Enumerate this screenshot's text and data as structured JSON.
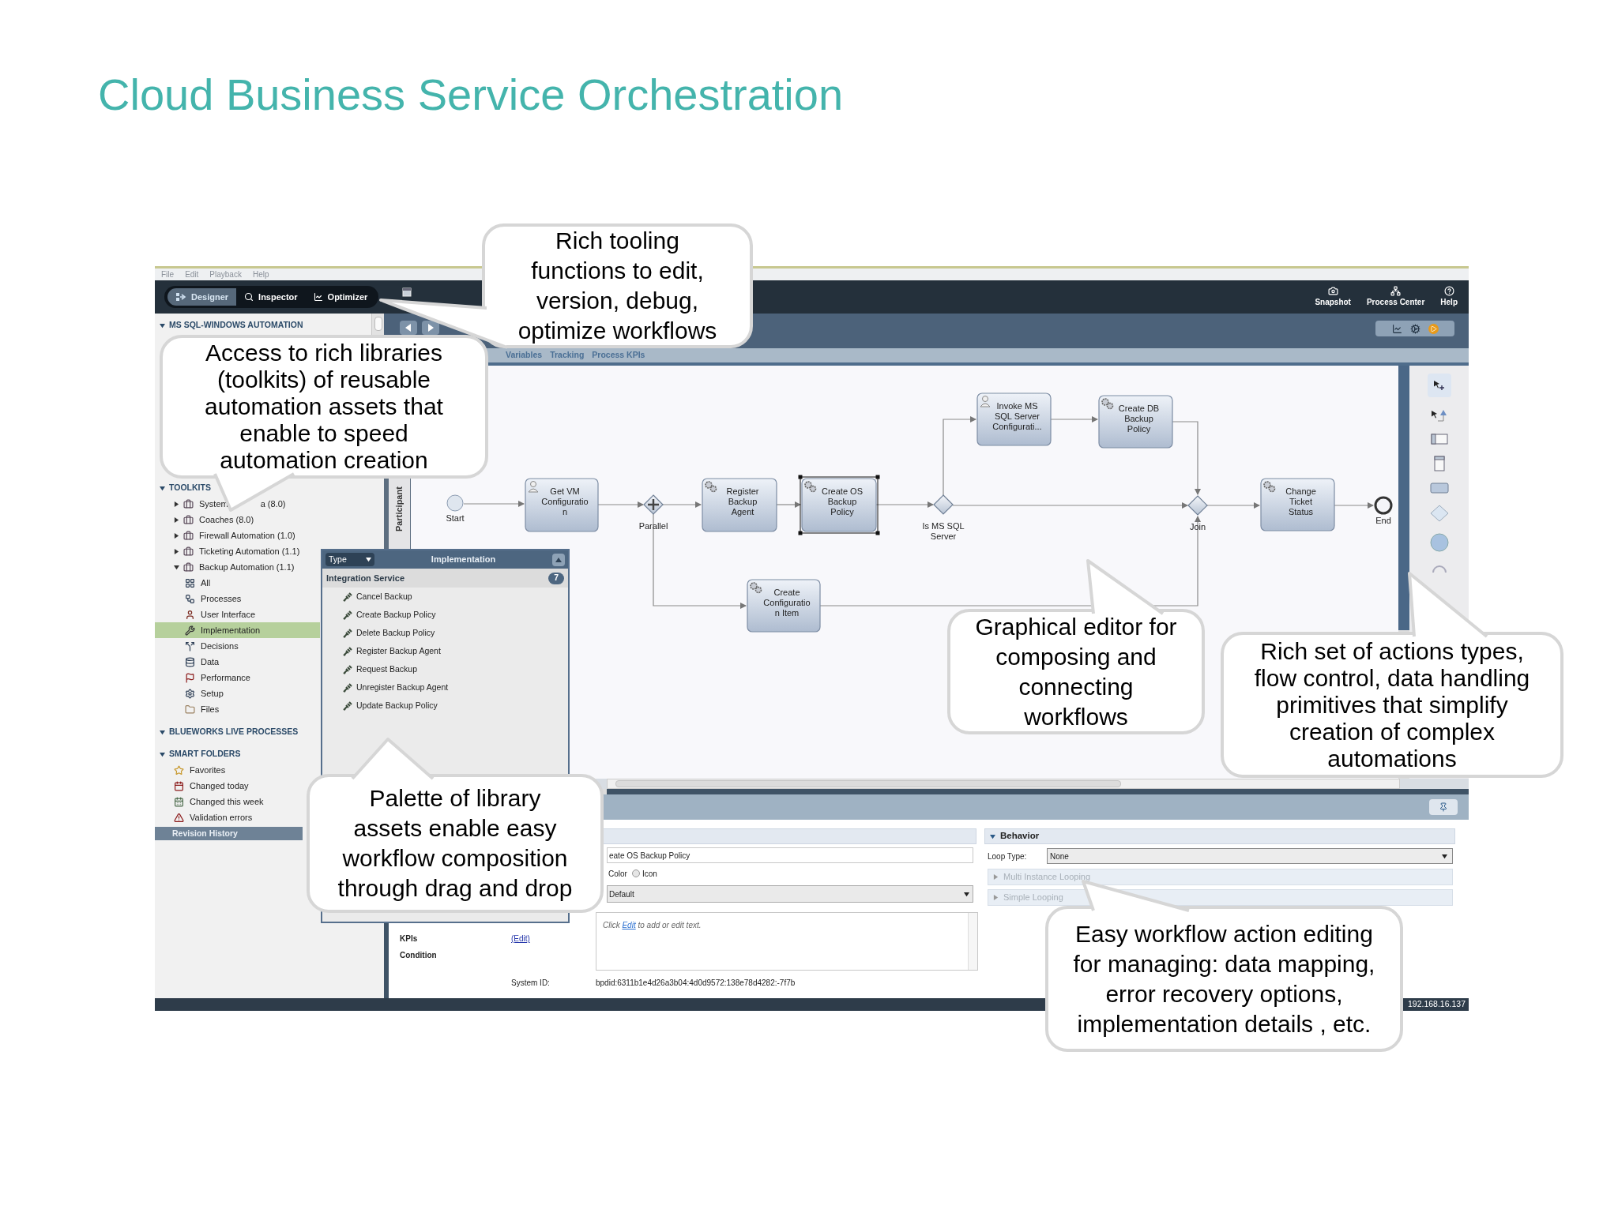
{
  "slide_title": "Cloud Business Service Orchestration",
  "app": {
    "menu": [
      "File",
      "Edit",
      "Playback",
      "Help"
    ],
    "modes": [
      {
        "label": "Designer",
        "selected": true
      },
      {
        "label": "Inspector",
        "selected": false
      },
      {
        "label": "Optimizer",
        "selected": false
      }
    ],
    "actions": [
      {
        "label": "Snapshot"
      },
      {
        "label": "Process Center"
      },
      {
        "label": "Help"
      }
    ],
    "sidebar": [
      {
        "title": "MS SQL-WINDOWS AUTOMATION",
        "expanded": true
      },
      {
        "title": "TOOLKITS",
        "expanded": true,
        "items": [
          {
            "label": "System",
            "label_end": "a (8.0)",
            "expanded": false,
            "selected": false
          },
          {
            "label": "Coaches (8.0)",
            "expanded": false,
            "selected": false
          },
          {
            "label": "Firewall Automation (1.0)",
            "expanded": false,
            "selected": false
          },
          {
            "label": "Ticketing Automation (1.1)",
            "expanded": false,
            "selected": false
          },
          {
            "label": "Backup Automation (1.1)",
            "expanded": true,
            "selected": false,
            "children": [
              {
                "label": "All",
                "selected": false
              },
              {
                "label": "Processes",
                "selected": false
              },
              {
                "label": "User Interface",
                "selected": false
              },
              {
                "label": "Implementation",
                "selected": true
              },
              {
                "label": "Decisions",
                "selected": false
              },
              {
                "label": "Data",
                "selected": false
              },
              {
                "label": "Performance",
                "selected": false
              },
              {
                "label": "Setup",
                "selected": false
              },
              {
                "label": "Files",
                "selected": false
              }
            ]
          }
        ]
      },
      {
        "title": "BLUEWORKS LIVE PROCESSES",
        "expanded": true
      },
      {
        "title": "SMART FOLDERS",
        "expanded": true,
        "items": [
          {
            "label": "Favorites",
            "selected": false
          },
          {
            "label": "Changed today",
            "selected": false
          },
          {
            "label": "Changed this week",
            "selected": false
          },
          {
            "label": "Validation errors",
            "selected": false
          }
        ]
      }
    ],
    "revision_history": "Revision History",
    "editor": {
      "tabs": [
        {
          "label": "Variables",
          "selected": false
        },
        {
          "label": "Tracking",
          "selected": false
        },
        {
          "label": "Process KPIs",
          "selected": false
        }
      ],
      "lane": "Participant",
      "nodes": [
        {
          "kind": "start",
          "lines": [
            "Start"
          ]
        },
        {
          "kind": "user_task",
          "lines": [
            "Get VM",
            "Configuratio",
            "n"
          ],
          "selected": false
        },
        {
          "kind": "parallel_gateway",
          "lines": [
            "Parallel"
          ]
        },
        {
          "kind": "system_task",
          "lines": [
            "Register",
            "Backup",
            "Agent"
          ],
          "selected": false
        },
        {
          "kind": "system_task",
          "lines": [
            "Create OS",
            "Backup",
            "Policy"
          ],
          "selected": true
        },
        {
          "kind": "exclusive_gateway",
          "lines": [
            "Is MS SQL",
            "Server"
          ]
        },
        {
          "kind": "user_task",
          "lines": [
            "Invoke MS",
            "SQL Server",
            "Configurati..."
          ],
          "selected": false
        },
        {
          "kind": "system_task",
          "lines": [
            "Create DB",
            "Backup",
            "Policy"
          ],
          "selected": false
        },
        {
          "kind": "exclusive_gateway",
          "lines": [
            "Join"
          ]
        },
        {
          "kind": "system_task",
          "lines": [
            "Change",
            "Ticket",
            "Status"
          ],
          "selected": false
        },
        {
          "kind": "end",
          "lines": [
            "End"
          ]
        },
        {
          "kind": "system_task",
          "lines": [
            "Create",
            "Configuratio",
            "n Item"
          ],
          "selected": false
        }
      ]
    },
    "palette": {
      "filter": "Type",
      "title": "Implementation",
      "group": "Integration Service",
      "count": "7",
      "items": [
        "Cancel Backup",
        "Create Backup Policy",
        "Delete Backup Policy",
        "Register Backup Agent",
        "Request Backup",
        "Unregister Backup Agent",
        "Update Backup Policy"
      ]
    },
    "properties": {
      "name_value": "eate OS Backup Policy",
      "color_label": "Color",
      "icon_radio": {
        "label": "Icon",
        "selected": false
      },
      "dropdown": "Default",
      "rows": [
        "KPIs",
        "Condition"
      ],
      "edit_link": "(Edit)",
      "hint": {
        "before": "Click",
        "link": "Edit",
        "after": "to add or edit text."
      },
      "system_id_label": "System ID:",
      "system_id": "bpdid:6311b1e4d26a3b04:4d0d9572:138e78d4282:-7f7b"
    },
    "behavior": {
      "title": "Behavior",
      "expanded": true,
      "loop_label": "Loop Type:",
      "loop_value": "None",
      "subsections": [
        {
          "label": "Multi Instance Looping",
          "disabled": true
        },
        {
          "label": "Simple Looping",
          "disabled": true
        }
      ]
    },
    "status": "192.168.16.137"
  },
  "callouts": [
    {
      "lines": [
        "Rich tooling",
        "functions to edit,",
        "version, debug,",
        "optimize workflows"
      ]
    },
    {
      "lines": [
        "Access to rich libraries",
        "(toolkits) of reusable",
        "automation assets that",
        "enable to speed",
        "automation creation"
      ]
    },
    {
      "lines": [
        "Palette of library",
        "assets enable easy",
        "workflow composition",
        "through drag and drop"
      ]
    },
    {
      "lines": [
        "Graphical editor for",
        "composing and",
        "connecting",
        "workflows"
      ]
    },
    {
      "lines": [
        "Rich set of actions types,",
        "flow control, data handling",
        "primitives that simplify",
        "creation of complex",
        "automations"
      ]
    },
    {
      "lines": [
        "Easy workflow action editing",
        "for managing: data mapping,",
        "error recovery options,",
        "implementation details , etc."
      ]
    }
  ]
}
